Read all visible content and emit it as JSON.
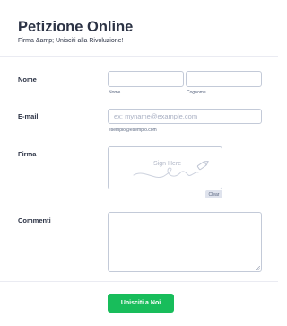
{
  "header": {
    "title": "Petizione Online",
    "subtitle": "Firma &amp; Unisciti alla Rivoluzione!"
  },
  "fields": {
    "name": {
      "label": "Nome",
      "first_value": "",
      "last_value": "",
      "first_sublabel": "Nome",
      "last_sublabel": "Cognome"
    },
    "email": {
      "label": "E-mail",
      "value": "",
      "placeholder": "ex: myname@example.com",
      "sublabel": "esempio@esempio.com"
    },
    "signature": {
      "label": "Firma",
      "placeholder": "Sign Here",
      "clear_label": "Clear"
    },
    "comments": {
      "label": "Commenti",
      "value": ""
    }
  },
  "submit": {
    "label": "Unisciti a Noi",
    "color": "#18bd5b"
  },
  "colors": {
    "text": "#2c3345",
    "input_border": "#c3cad8",
    "divider": "#eaebf2"
  }
}
